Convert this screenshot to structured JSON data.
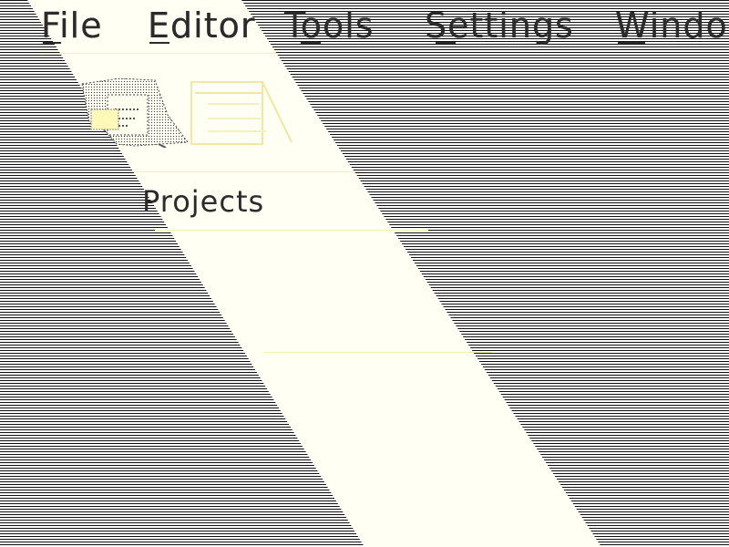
{
  "menu": {
    "file": "File",
    "editor": "Editor",
    "tools": "Tools",
    "settings": "Settings",
    "window": "Windo"
  },
  "toolbar": {
    "icons": [
      "open-project-icon",
      "panel-layout-icon"
    ]
  },
  "sidebar": {
    "section_title": "Projects"
  },
  "colors": {
    "band": "#fffff4",
    "divider": "#f2f2a8",
    "text": "#2b2b2b",
    "scanline": "#111111"
  }
}
